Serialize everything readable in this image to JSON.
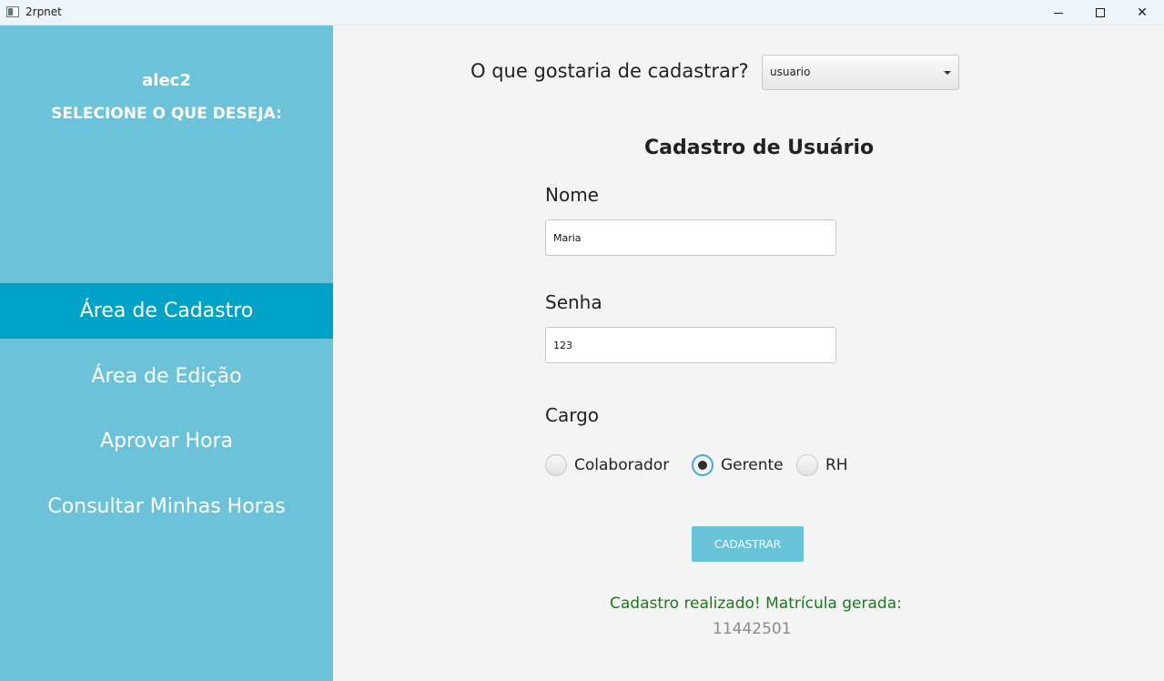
{
  "window": {
    "title": "2rpnet",
    "controls": {
      "minimize": "—",
      "maximize": "□",
      "close": "✕"
    }
  },
  "sidebar": {
    "user": "alec2",
    "prompt": "SELECIONE O QUE DESEJA:",
    "items": [
      {
        "label": "Área de Cadastro",
        "active": true
      },
      {
        "label": "Área de Edição",
        "active": false
      },
      {
        "label": "Aprovar Hora",
        "active": false
      },
      {
        "label": "Consultar Minhas Horas",
        "active": false
      }
    ]
  },
  "main": {
    "question": "O que gostaria de cadastrar?",
    "dropdown": {
      "selected": "usuario"
    },
    "form_title": "Cadastro de Usuário",
    "name": {
      "label": "Nome",
      "value": "Maria"
    },
    "password": {
      "label": "Senha",
      "value": "123"
    },
    "role": {
      "label": "Cargo",
      "options": [
        {
          "label": "Colaborador",
          "selected": false
        },
        {
          "label": "Gerente",
          "selected": true
        },
        {
          "label": "RH",
          "selected": false
        }
      ]
    },
    "submit_label": "CADASTRAR",
    "success_message": "Cadastro realizado! Matrícula gerada:",
    "registration_number": "11442501"
  },
  "colors": {
    "sidebar": "#6cc3d9",
    "active_item": "#00a2c7",
    "success": "#1a7a1a",
    "button": "#68c2d8"
  }
}
